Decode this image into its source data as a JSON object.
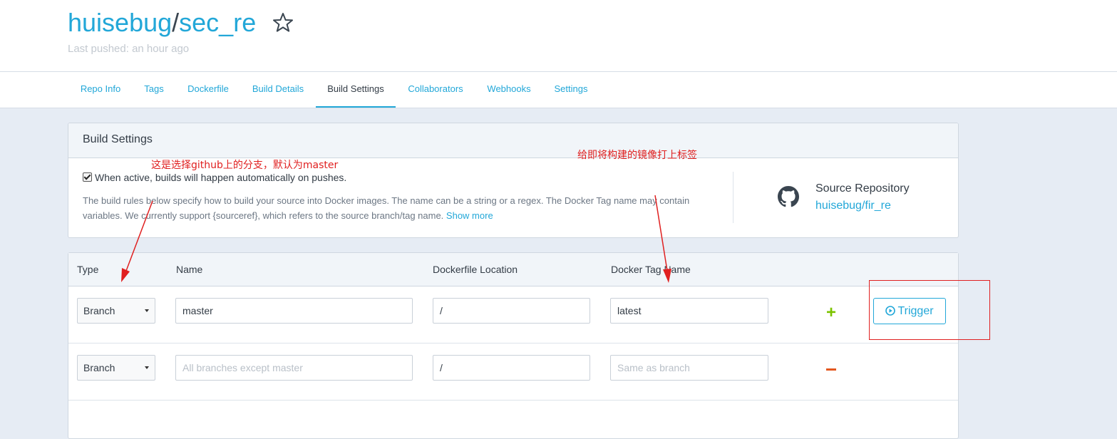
{
  "repo": {
    "owner": "huisebug",
    "separator": "/",
    "name": "sec_re",
    "last_pushed": "Last pushed: an hour ago"
  },
  "tabs": [
    {
      "label": "Repo Info",
      "active": false
    },
    {
      "label": "Tags",
      "active": false
    },
    {
      "label": "Dockerfile",
      "active": false
    },
    {
      "label": "Build Details",
      "active": false
    },
    {
      "label": "Build Settings",
      "active": true
    },
    {
      "label": "Collaborators",
      "active": false
    },
    {
      "label": "Webhooks",
      "active": false
    },
    {
      "label": "Settings",
      "active": false
    }
  ],
  "build_settings": {
    "title": "Build Settings",
    "autobuild_checked": true,
    "autobuild_label": "When active, builds will happen automatically on pushes.",
    "description": "The build rules below specify how to build your source into Docker images. The name can be a string or a regex. The Docker Tag name may contain variables. We currently support {sourceref}, which refers to the source branch/tag name.",
    "show_more": "Show more",
    "source_repo_label": "Source Repository",
    "source_repo_link": "huisebug/fir_re"
  },
  "table": {
    "columns": {
      "type": "Type",
      "name": "Name",
      "dockerfile_location": "Dockerfile Location",
      "docker_tag_name": "Docker Tag Name"
    },
    "rows": [
      {
        "type": "Branch",
        "name_value": "master",
        "name_placeholder": "",
        "location_value": "/",
        "tag_value": "latest",
        "tag_placeholder": "",
        "action": "+"
      },
      {
        "type": "Branch",
        "name_value": "",
        "name_placeholder": "All branches except master",
        "location_value": "/",
        "tag_value": "",
        "tag_placeholder": "Same as branch",
        "action": "-"
      }
    ],
    "trigger_label": "Trigger"
  },
  "annotations": {
    "left": "这是选择github上的分支，默认为master",
    "right": "给即将构建的镜像打上标签"
  },
  "colors": {
    "accent": "#22a7d8",
    "add": "#7cc300",
    "remove": "#e3581f",
    "annotation": "#e02020"
  }
}
